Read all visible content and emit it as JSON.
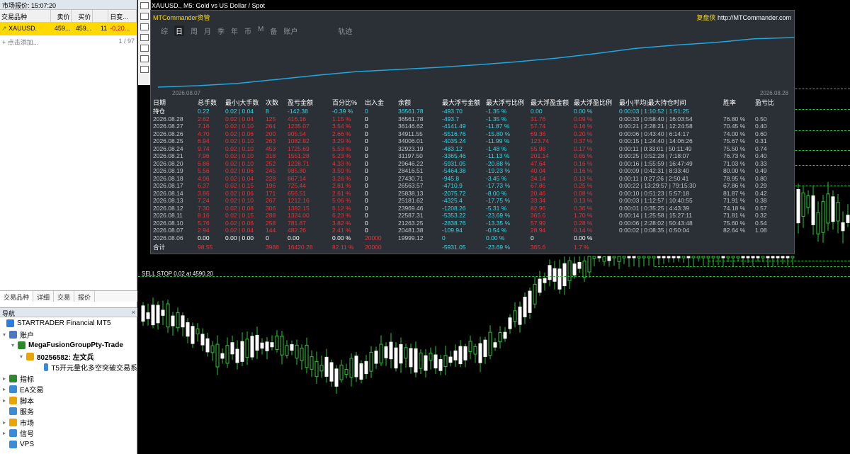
{
  "market_watch": {
    "title": "市场报价: 15:07:20",
    "headers": [
      "交易品种",
      "卖价",
      "买价",
      "",
      "日变..."
    ],
    "row": {
      "symbol": "XAUUSD.",
      "bid": "459...",
      "ask": "459...",
      "spread": "11",
      "change": "-0.20..."
    },
    "add_label": "点击添加...",
    "count": "1 / 97",
    "tabs": [
      "交易品种",
      "详细",
      "交易",
      "报价"
    ]
  },
  "navigator": {
    "title": "导航",
    "close": "×",
    "items": [
      {
        "label": "STARTRADER Financial MT5"
      },
      {
        "label": "账户"
      },
      {
        "label": "MegaFusionGroupPty-Trade"
      },
      {
        "label": "80256582: 左文兵"
      },
      {
        "label": "T5开元量化多空突破交易系"
      },
      {
        "label": "指标"
      },
      {
        "label": "EA交易"
      },
      {
        "label": "脚本"
      },
      {
        "label": "服务"
      },
      {
        "label": "市场"
      },
      {
        "label": "信号"
      },
      {
        "label": "VPS"
      }
    ]
  },
  "chart": {
    "title": "XAUUSD., M5:  Gold vs US Dollar / Spot",
    "sell_stop": "SELL STOP 0.02 at 4590.20"
  },
  "panel": {
    "title": "MTCommander资管",
    "brand": "复盘侠",
    "url": "http://MTCommander.com",
    "tabs": [
      "综",
      "日",
      "周",
      "月",
      "季",
      "年",
      "币",
      "M",
      "备",
      "账户",
      "轨迹"
    ],
    "active_tab": "日",
    "date_start": "2026.08.07",
    "date_end": "2026.08.28",
    "columns": [
      "日期",
      "总手数",
      "最小|大手数",
      "次数",
      "盈亏金额",
      "百分比%",
      "出入金",
      "余额",
      "最大浮亏金额",
      "最大浮亏比例",
      "最大浮盈金额",
      "最大浮盈比例",
      "最小|平均|最大持仓时间",
      "胜率",
      "盈亏比"
    ],
    "holding": [
      "持仓",
      "0.22",
      "0.02 | 0.04",
      "8",
      "-142.38",
      "-0.39 %",
      "0",
      "36561.78",
      "-493.70",
      "-1.35 %",
      "0.00",
      "0.00 %",
      "0:00:03 | 1:10:52 | 1:51:25",
      "",
      ""
    ],
    "rows": [
      [
        "2026.08.28",
        "2.62",
        "0.02 | 0.04",
        "125",
        "416.16",
        "1.15 %",
        "0",
        "36561.78",
        "-493.7",
        "-1.35 %",
        "31.76",
        "0.09 %",
        "0:00:33 | 0:58:40 | 16:03:54",
        "76.80 %",
        "0.50"
      ],
      [
        "2026.08.27",
        "7.16",
        "0.02 | 0.10",
        "264",
        "1235.07",
        "3.54 %",
        "0",
        "36146.62",
        "-4141.49",
        "-11.87 %",
        "57.74",
        "0.16 %",
        "0:00:21 | 2:28:21 | 12:24:58",
        "70.45 %",
        "0.40"
      ],
      [
        "2026.08.26",
        "4.70",
        "0.02 | 0.06",
        "200",
        "905.54",
        "2.66 %",
        "0",
        "34911.55",
        "-5516.76",
        "-15.80 %",
        "69.36",
        "0.20 %",
        "0:00:06 | 0:43:40 | 6:14:17",
        "74.00 %",
        "0.60"
      ],
      [
        "2026.08.25",
        "6.94",
        "0.02 | 0.10",
        "263",
        "1082.82",
        "3.29 %",
        "0",
        "34006.01",
        "-4035.24",
        "-11.99 %",
        "123.74",
        "0.37 %",
        "0:00:15 | 1:24:40 | 14:06:26",
        "75.67 %",
        "0.31"
      ],
      [
        "2026.08.24",
        "9.74",
        "0.02 | 0.10",
        "453",
        "1725.69",
        "5.53 %",
        "0",
        "32923.19",
        "-483.12",
        "-1.48 %",
        "55.98",
        "0.17 %",
        "0:00:11 | 0:33:01 | 50:11:49",
        "75.50 %",
        "0.74"
      ],
      [
        "2026.08.21",
        "7.96",
        "0.02 | 0.10",
        "318",
        "1551.28",
        "5.23 %",
        "0",
        "31197.50",
        "-3365.46",
        "-11.13 %",
        "201.14",
        "0.65 %",
        "0:00:25 | 0:52:28 | 7:18:07",
        "76.73 %",
        "0.40"
      ],
      [
        "2026.08.20",
        "6.86",
        "0.02 | 0.10",
        "252",
        "1228.71",
        "4.33 %",
        "0",
        "29646.22",
        "-5931.05",
        "-20.88 %",
        "47.64",
        "0.16 %",
        "0:00:16 | 1:55:59 | 16:47:49",
        "71.03 %",
        "0.33"
      ],
      [
        "2026.08.19",
        "5.56",
        "0.02 | 0.06",
        "245",
        "985.80",
        "3.59 %",
        "0",
        "28416.51",
        "-5464.38",
        "-19.23 %",
        "40.04",
        "0.16 %",
        "0:00:09 | 0:42:31 | 8:33:40",
        "80.00 %",
        "0.49"
      ],
      [
        "2026.08.18",
        "4.06",
        "0.02 | 0.04",
        "228",
        "867.14",
        "3.26 %",
        "0",
        "27430.71",
        "-945.8",
        "-3.45 %",
        "34.14",
        "0.13 %",
        "0:00:11 | 0:27:26 | 2:50:41",
        "78.95 %",
        "0.80"
      ],
      [
        "2026.08.17",
        "6.37",
        "0.02 | 0.15",
        "196",
        "725.44",
        "2.81 %",
        "0",
        "26563.57",
        "-4710.9",
        "-17.73 %",
        "67.86",
        "0.25 %",
        "0:00:22 | 13:29:57 | 79:15:30",
        "67.86 %",
        "0.29"
      ],
      [
        "2026.08.14",
        "3.86",
        "0.02 | 0.06",
        "171",
        "656.51",
        "2.61 %",
        "0",
        "25838.13",
        "-2075.72",
        "-8.00 %",
        "20.46",
        "0.08 %",
        "0:00:10 | 0:51:23 | 5:57:18",
        "81.87 %",
        "0.42"
      ],
      [
        "2026.08.13",
        "7.24",
        "0.02 | 0.10",
        "267",
        "1212.16",
        "5.06 %",
        "0",
        "25181.62",
        "-4325.4",
        "-17.75 %",
        "33.34",
        "0.13 %",
        "0:00:03 | 1:12:57 | 10:40:55",
        "71.91 %",
        "0.38"
      ],
      [
        "2026.08.12",
        "7.30",
        "0.02 | 0.08",
        "306",
        "1382.15",
        "6.12 %",
        "0",
        "23969.46",
        "-1208.26",
        "-5.31 %",
        "82.96",
        "0.36 %",
        "0:00:01 | 0:35:25 | 4:43:39",
        "74.18 %",
        "0.57"
      ],
      [
        "2026.08.11",
        "8.16",
        "0.02 | 0.15",
        "288",
        "1324.00",
        "6.23 %",
        "0",
        "22587.31",
        "-5353.22",
        "-23.69 %",
        "365.6",
        "1.70 %",
        "0:00:14 | 1:25:58 | 15:27:11",
        "71.81 %",
        "0.32"
      ],
      [
        "2026.08.10",
        "5.76",
        "0.02 | 0.06",
        "258",
        "781.87",
        "3.82 %",
        "0",
        "21263.25",
        "-2838.76",
        "-13.35 %",
        "57.99",
        "0.28 %",
        "0:00:06 | 2:28:02 | 50:43:48",
        "75.60 %",
        "0.54"
      ],
      [
        "2026.08.07",
        "2.94",
        "0.02 | 0.04",
        "144",
        "482.26",
        "2.41 %",
        "0",
        "20481.38",
        "-109.94",
        "-0.54 %",
        "28.94",
        "0.14 %",
        "0:00:02 | 0:08:35 | 0:50:04",
        "82.64 %",
        "1.08"
      ],
      [
        "2026.08.06",
        "0.00",
        "0.00 | 0.00",
        "0",
        "0.00",
        "0.00 %",
        "20000",
        "19999.12",
        "0",
        "0.00 %",
        "0",
        "0.00 %",
        "",
        "",
        ""
      ]
    ],
    "totals": [
      "合计",
      "98.55",
      "",
      "3988",
      "16420.28",
      "82.11 %",
      "20000",
      "",
      "-5931.05",
      "-23.69 %",
      "365.6",
      "1.7 %",
      "",
      "",
      ""
    ]
  },
  "curve_data": {
    "type": "line",
    "x": [
      "2026.08.06",
      "2026.08.07",
      "2026.08.10",
      "2026.08.11",
      "2026.08.12",
      "2026.08.13",
      "2026.08.14",
      "2026.08.17",
      "2026.08.18",
      "2026.08.19",
      "2026.08.20",
      "2026.08.21",
      "2026.08.24",
      "2026.08.25",
      "2026.08.26",
      "2026.08.27",
      "2026.08.28"
    ],
    "values": [
      19999.12,
      20481.38,
      21263.25,
      22587.31,
      23969.46,
      25181.62,
      25838.13,
      26563.57,
      27430.71,
      28416.51,
      29646.22,
      31197.5,
      32923.19,
      34006.01,
      34911.55,
      36146.62,
      36561.78
    ],
    "color": "#1fa7e0"
  },
  "colors": {
    "accent": "#ffd900",
    "up": "#2ec33a",
    "loss": "#e0353b",
    "cyan": "#34d6e6"
  }
}
